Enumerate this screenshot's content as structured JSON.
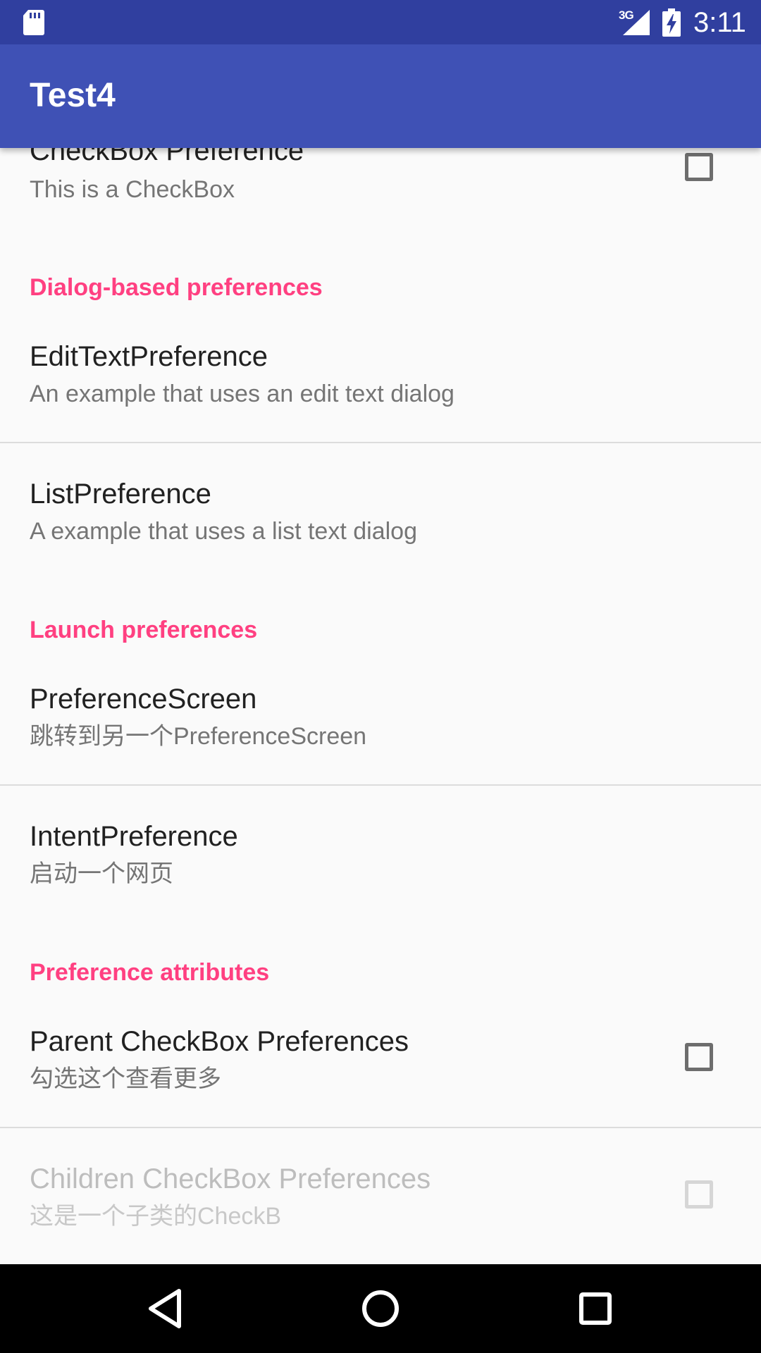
{
  "status_bar": {
    "network_type": "3G",
    "time": "3:11",
    "icons": [
      "sd-card-icon",
      "signal-icon",
      "battery-charging-icon"
    ]
  },
  "app_bar": {
    "title": "Test4"
  },
  "preferences": {
    "checkbox_pref": {
      "title": "CheckBox Preference",
      "summary": "This is a CheckBox",
      "checked": false
    },
    "category_dialog": "Dialog-based preferences",
    "edit_text_pref": {
      "title": "EditTextPreference",
      "summary": "An example that uses an edit text dialog"
    },
    "list_pref": {
      "title": "ListPreference",
      "summary": "A example that uses a list text dialog"
    },
    "category_launch": "Launch preferences",
    "preference_screen": {
      "title": "PreferenceScreen",
      "summary": "跳转到另一个PreferenceScreen"
    },
    "intent_pref": {
      "title": "IntentPreference",
      "summary": "启动一个网页"
    },
    "category_attributes": "Preference attributes",
    "parent_checkbox": {
      "title": "Parent CheckBox Preferences",
      "summary": "勾选这个查看更多",
      "checked": false
    },
    "child_checkbox": {
      "title": "Children CheckBox Preferences",
      "summary": "这是一个子类的CheckB",
      "checked": false,
      "enabled": false
    }
  },
  "nav_bar": {
    "icons": [
      "back-icon",
      "home-icon",
      "recents-icon"
    ]
  },
  "colors": {
    "status_bar": "#303f9f",
    "app_bar": "#3f51b5",
    "accent": "#ff4081",
    "background": "#fafafa"
  }
}
